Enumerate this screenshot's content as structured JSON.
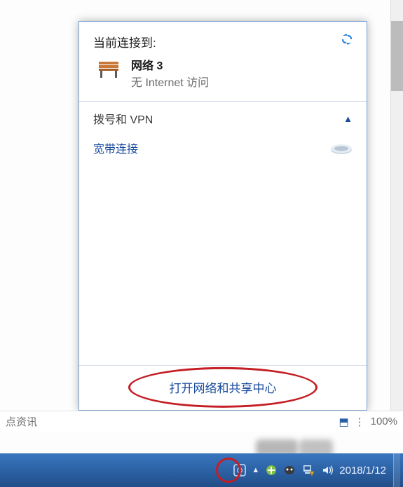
{
  "popup": {
    "header_title": "当前连接到:",
    "refresh_icon": "refresh",
    "connection": {
      "name": "网络  3",
      "status": "无 Internet 访问"
    },
    "dialup_section_label": "拨号和 VPN",
    "dialup_item": "宽带连接",
    "footer_link": "打开网络和共享中心"
  },
  "status_strip": {
    "left_text": "点资讯",
    "zoom": "100%"
  },
  "taskbar": {
    "date": "2018/1/12"
  }
}
